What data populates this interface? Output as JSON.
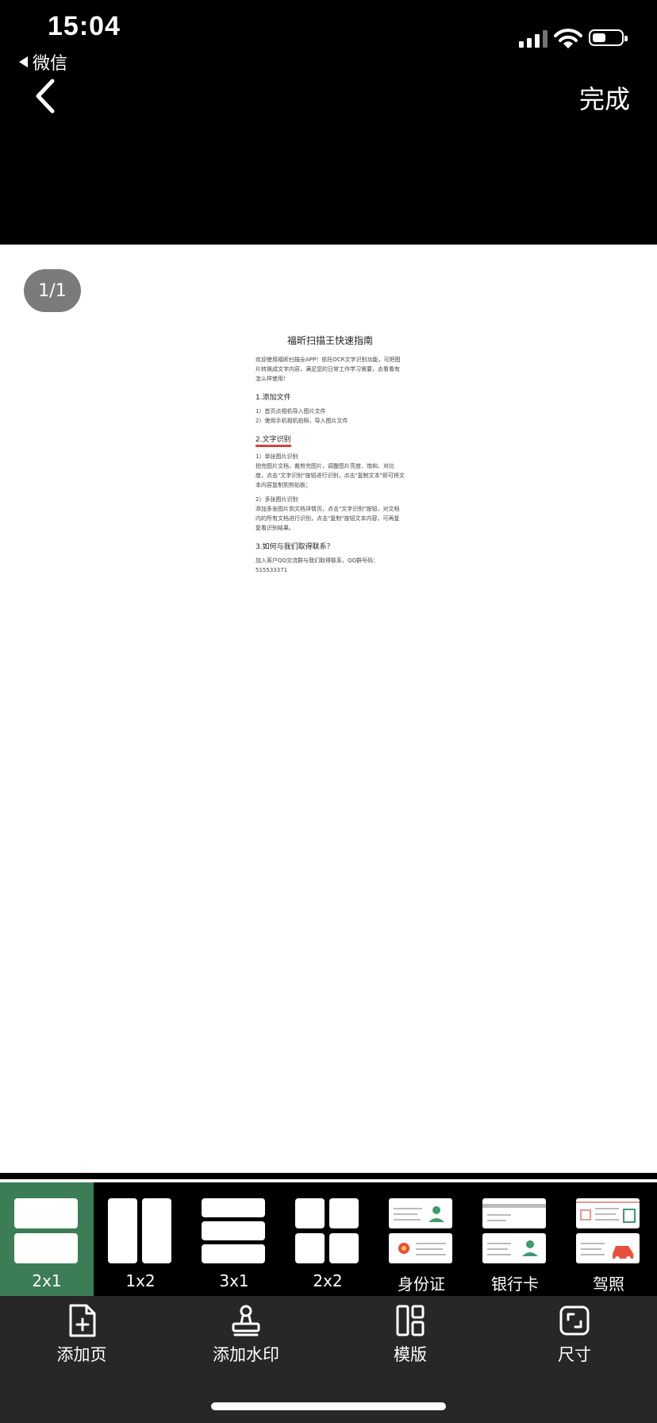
{
  "status": {
    "time": "15:04",
    "back_app": "微信"
  },
  "nav": {
    "done_label": "完成"
  },
  "viewer": {
    "page_indicator": "1/1"
  },
  "document": {
    "title": "福昕扫描王快速指南",
    "intro": "欢迎使用福昕扫描全APP！依托OCR文字识别功能，可把图片转换成文字内容，满足您的日常工作学习需要，去看看有怎么样使用！",
    "s1_title": "1.添加文件",
    "s1_l1": "1）首页点相机导入图片文件",
    "s1_l2": "2）使用手机相机拍照，导入图片文件",
    "s2_title": "2.文字识别",
    "s2_sub1": "1）单张图片识别",
    "s2_p1": "拍完图片文档，裁剪完图片，调整图片亮度、饱和、对比度，点击\"文字识别\"按钮进行识别，点击\"复制文本\"即可将文本内容复制到剪贴板；",
    "s2_sub2": "2）多张图片识别",
    "s2_p2": "添加多张图片到文档详情页，点击\"文字识别\"按钮，对文档内的所有文档进行识别，点击\"复制\"按钮文本内容，可再复复看识别结果。",
    "s3_title": "3.如何与我们取得联系？",
    "s3_p": "加入客户QQ交流群与我们取得联系，QQ群号码：",
    "s3_qq": "515533371"
  },
  "templates": [
    {
      "label": "2x1",
      "selected": true
    },
    {
      "label": "1x2",
      "selected": false
    },
    {
      "label": "3x1",
      "selected": false
    },
    {
      "label": "2x2",
      "selected": false
    },
    {
      "label": "身份证",
      "selected": false
    },
    {
      "label": "银行卡",
      "selected": false
    },
    {
      "label": "驾照",
      "selected": false
    }
  ],
  "toolbar": {
    "add_page": "添加页",
    "add_watermark": "添加水印",
    "template": "模版",
    "size": "尺寸"
  },
  "colors": {
    "selected_template_bg": "#3c7d55",
    "toolbar_bg": "#272727",
    "highlight_underline": "#d6423a"
  }
}
